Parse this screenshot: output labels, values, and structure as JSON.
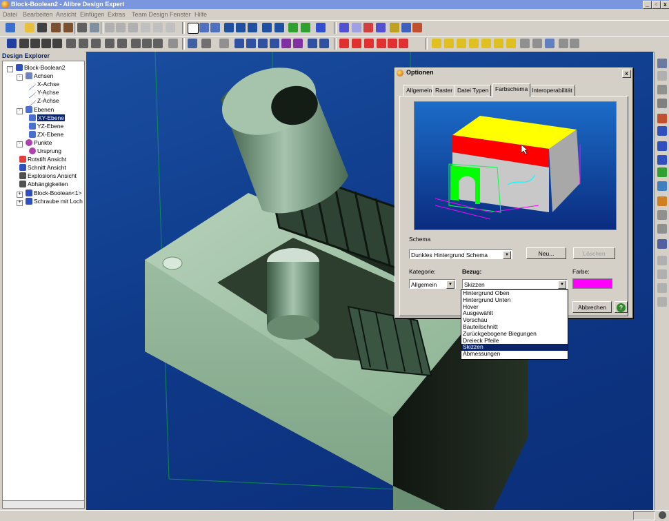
{
  "window": {
    "title": "Block-Boolean2 - Alibre Design Expert"
  },
  "menu": [
    "Datei",
    "Bearbeiten",
    "Ansicht",
    "Einfügen",
    "Extras",
    "Team Design",
    "Fenster",
    "Hilfe"
  ],
  "explorer": {
    "header": "Design Explorer",
    "tree": [
      {
        "label": "Block-Boolean2",
        "toggle": "-",
        "level": 0,
        "icon": "part-icon"
      },
      {
        "label": "Achsen",
        "toggle": "-",
        "level": 1,
        "icon": "axes-icon"
      },
      {
        "label": "X-Achse",
        "toggle": "",
        "level": 2,
        "icon": "axis-icon"
      },
      {
        "label": "Y-Achse",
        "toggle": "",
        "level": 2,
        "icon": "axis-icon"
      },
      {
        "label": "Z-Achse",
        "toggle": "",
        "level": 2,
        "icon": "axis-icon"
      },
      {
        "label": "Ebenen",
        "toggle": "-",
        "level": 1,
        "icon": "planes-icon"
      },
      {
        "label": "XY-Ebene",
        "toggle": "",
        "level": 2,
        "icon": "plane-icon",
        "selected": true
      },
      {
        "label": "YZ-Ebene",
        "toggle": "",
        "level": 2,
        "icon": "plane-icon"
      },
      {
        "label": "ZX-Ebene",
        "toggle": "",
        "level": 2,
        "icon": "plane-icon"
      },
      {
        "label": "Punkte",
        "toggle": "-",
        "level": 1,
        "icon": "points-icon"
      },
      {
        "label": "Ursprung",
        "toggle": "",
        "level": 2,
        "icon": "origin-icon"
      },
      {
        "label": "Rotstift Ansicht",
        "toggle": "",
        "level": 1,
        "icon": "redline-icon"
      },
      {
        "label": "Schnitt Ansicht",
        "toggle": "",
        "level": 1,
        "icon": "section-icon"
      },
      {
        "label": "Explosions Ansicht",
        "toggle": "",
        "level": 1,
        "icon": "explode-icon"
      },
      {
        "label": "Abhängigkeiten",
        "toggle": "",
        "level": 1,
        "icon": "constraints-icon"
      },
      {
        "label": "Block-Boolean<1>",
        "toggle": "+",
        "level": 1,
        "icon": "part-icon"
      },
      {
        "label": "Schraube mit Loch",
        "toggle": "+",
        "level": 1,
        "icon": "part-icon"
      }
    ]
  },
  "dialog": {
    "title": "Optionen",
    "tabs": [
      "Allgemein",
      "Raster",
      "Datei Typen",
      "Farbschema",
      "Interoperabilität"
    ],
    "active_tab": "Farbschema",
    "schema_label": "Schema",
    "schema_value": "Dunkles Hintergrund Schema",
    "new_button": "Neu...",
    "delete_button": "Löschen",
    "kategorie_label": "Kategorie:",
    "kategorie_value": "Allgemein",
    "bezug_label": "Bezug:",
    "bezug_value": "Skizzen",
    "farbe_label": "Farbe:",
    "farbe_color": "#ff00ff",
    "cancel_button": "Abbrechen",
    "help_button": "?"
  },
  "bezug_options": [
    "Hintergrund Oben",
    "Hintergrund Unten",
    "Hover",
    "Ausgewählt",
    "Vorschau",
    "Bauteilschnitt",
    "Zurückgebogene Biegungen",
    "Dreieck Pfeile",
    "Skizzen",
    "Abmessungen"
  ],
  "bezug_highlighted": "Skizzen",
  "colors": {
    "viewport_bg": "#0f3a8a",
    "model": "#8fb596",
    "selection": "#0a246a",
    "sketch": "#ff00ff"
  }
}
